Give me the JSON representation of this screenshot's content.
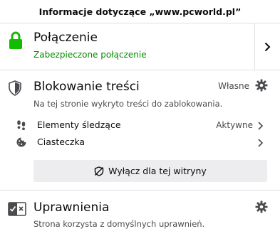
{
  "header": {
    "title": "Informacje dotyczące „www.pcworld.pl”"
  },
  "connection": {
    "title": "Połączenie",
    "status": "Zabezpieczone połączenie",
    "icon": "lock-icon",
    "status_color": "#058b00"
  },
  "blocking": {
    "title": "Blokowanie treści",
    "mode": "Własne",
    "description": "Na tej stronie wykryto treści do zablokowania.",
    "items": [
      {
        "label": "Elementy śledzące",
        "state": "Aktywne",
        "icon": "footprints-icon"
      },
      {
        "label": "Ciasteczka",
        "state": "",
        "icon": "cookie-icon"
      }
    ],
    "disable_button": "Wyłącz dla tej witryny"
  },
  "permissions": {
    "title": "Uprawnienia",
    "description": "Strona korzysta z domyślnych uprawnień."
  }
}
